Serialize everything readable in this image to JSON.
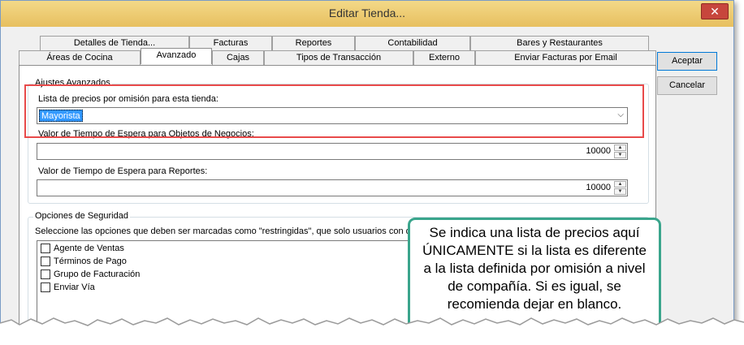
{
  "window": {
    "title": "Editar Tienda..."
  },
  "icons": {
    "close": "close-icon",
    "dropdown": "chevron-down-icon",
    "spin_up": "chevron-up-icon",
    "spin_down": "chevron-down-icon"
  },
  "tabs": {
    "row_back": [
      {
        "label": "Detalles de Tienda..."
      },
      {
        "label": "Facturas"
      },
      {
        "label": "Reportes"
      },
      {
        "label": "Contabilidad"
      },
      {
        "label": "Bares y Restaurantes"
      }
    ],
    "row_front": [
      {
        "label": "Áreas de Cocina"
      },
      {
        "label": "Avanzado"
      },
      {
        "label": "Cajas"
      },
      {
        "label": "Tipos de Transacción"
      },
      {
        "label": "Externo"
      },
      {
        "label": "Enviar Facturas por Email"
      }
    ],
    "active": "Avanzado"
  },
  "advanced": {
    "group_label": "Ajustes Avanzados",
    "pricelist_label": "Lista de precios por omisión para esta tienda:",
    "pricelist_value": "Mayorista",
    "timeout_business_label": "Valor de Tiempo de Espera para Objetos de Negocios:",
    "timeout_business_value": "10000",
    "timeout_reports_label": "Valor de Tiempo de Espera para Reportes:",
    "timeout_reports_value": "10000"
  },
  "security": {
    "group_label": "Opciones de Seguridad",
    "instructions": "Seleccione las opciones que deben ser marcadas como \"restringidas\", que solo usuarios con de",
    "options": [
      {
        "label": "Agente de Ventas",
        "checked": false
      },
      {
        "label": "Términos de Pago",
        "checked": false
      },
      {
        "label": "Grupo de Facturación",
        "checked": false
      },
      {
        "label": "Enviar Vía",
        "checked": false
      }
    ]
  },
  "buttons": {
    "accept": "Aceptar",
    "cancel": "Cancelar"
  },
  "callout": {
    "text": "Se indica una lista de precios aquí ÚNICAMENTE si la lista es diferente a la lista definida por omisión a nivel de compañía. Si es igual, se recomienda dejar en blanco.",
    "border_color": "#3aa58c"
  },
  "colors": {
    "highlight": "#e84a4a",
    "selection": "#3399ff"
  }
}
